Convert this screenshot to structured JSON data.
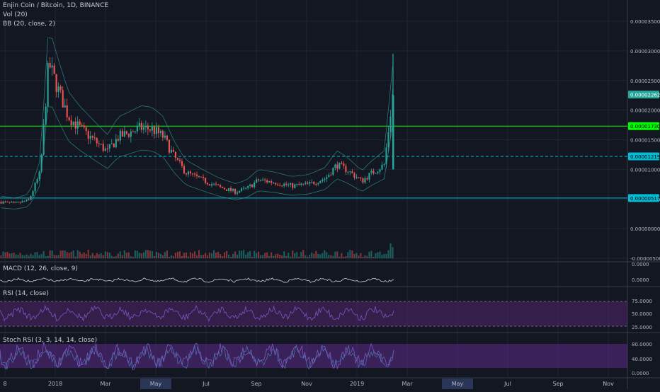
{
  "header": {
    "symbol_title": "Enjin Coin / Bitcoin, 1D, BINANCE",
    "vol_label": "Vol (20)",
    "bb_label": "BB (20, close, 2)"
  },
  "panes": {
    "macd_label": "MACD (12, 26, close, 9)",
    "rsi_label": "RSI (14, close)",
    "stoch_label": "Stoch RSI (3, 3, 14, 14, close)"
  },
  "colors": {
    "background": "#131722",
    "grid": "#1f2433",
    "up": "#26a69a",
    "down": "#ef5350",
    "bollinger": "#2f8f8a",
    "green_level": "#00ff00",
    "cyan_level": "#00bcd4",
    "rsi_band": "#5a2b7a",
    "stoch_band": "#6a2fa0",
    "oscillator": "#7e57c2",
    "highlight_month": "#2a3657"
  },
  "time_axis": {
    "labels": [
      "8",
      "2018",
      "Mar",
      "May",
      "Jul",
      "Sep",
      "Nov",
      "2019",
      "Mar",
      "May",
      "Jul",
      "Sep",
      "Nov"
    ],
    "highlighted": "May"
  },
  "chart_data": {
    "type": "candlestick",
    "price_axis": {
      "ticks": [
        "0.00003500",
        "0.00003000",
        "0.00002500",
        "0.00002000",
        "0.00001500",
        "0.00001000",
        "0.00000500",
        "0.00000000",
        "-0.00000500"
      ]
    },
    "price_tags": [
      {
        "label": "0.00002262",
        "value": 2.262e-05,
        "kind": "last-price"
      },
      {
        "label": "0.00001730",
        "value": 1.73e-05,
        "kind": "green-level"
      },
      {
        "label": "0.00001219",
        "value": 1.219e-05,
        "kind": "cyan-dashed-level"
      },
      {
        "label": "0.00000517",
        "value": 5.17e-06,
        "kind": "cyan-level"
      }
    ],
    "macd_axis": [
      "0.0000",
      "0.0000"
    ],
    "rsi_axis": [
      "75.0000",
      "50.0000",
      "25.0000"
    ],
    "stoch_axis": [
      "80.0000",
      "40.0000",
      "0.0000"
    ],
    "price_path": [
      [
        0,
        4.5e-06
      ],
      [
        0.025,
        4.2e-06
      ],
      [
        0.05,
        4.8e-06
      ],
      [
        0.07,
        9.5e-06
      ],
      [
        0.085,
        2.8e-05
      ],
      [
        0.1,
        2.4e-05
      ],
      [
        0.12,
        1.9e-05
      ],
      [
        0.14,
        1.7e-05
      ],
      [
        0.165,
        1.5e-05
      ],
      [
        0.19,
        1.3e-05
      ],
      [
        0.21,
        1.55e-05
      ],
      [
        0.225,
        1.6e-05
      ],
      [
        0.25,
        1.7e-05
      ],
      [
        0.27,
        1.68e-05
      ],
      [
        0.29,
        1.55e-05
      ],
      [
        0.31,
        1.2e-05
      ],
      [
        0.33,
        9.5e-06
      ],
      [
        0.36,
        8.2e-06
      ],
      [
        0.39,
        7e-06
      ],
      [
        0.42,
        6.2e-06
      ],
      [
        0.44,
        6.8e-06
      ],
      [
        0.46,
        8.2e-06
      ],
      [
        0.49,
        7.8e-06
      ],
      [
        0.52,
        7.2e-06
      ],
      [
        0.55,
        7.5e-06
      ],
      [
        0.58,
        8.5e-06
      ],
      [
        0.6,
        1.08e-05
      ],
      [
        0.62,
        9.8e-06
      ],
      [
        0.645,
        8e-06
      ],
      [
        0.66,
        9.2e-06
      ],
      [
        0.685,
        1.08e-05
      ],
      [
        0.7,
        2.25e-05
      ]
    ]
  }
}
